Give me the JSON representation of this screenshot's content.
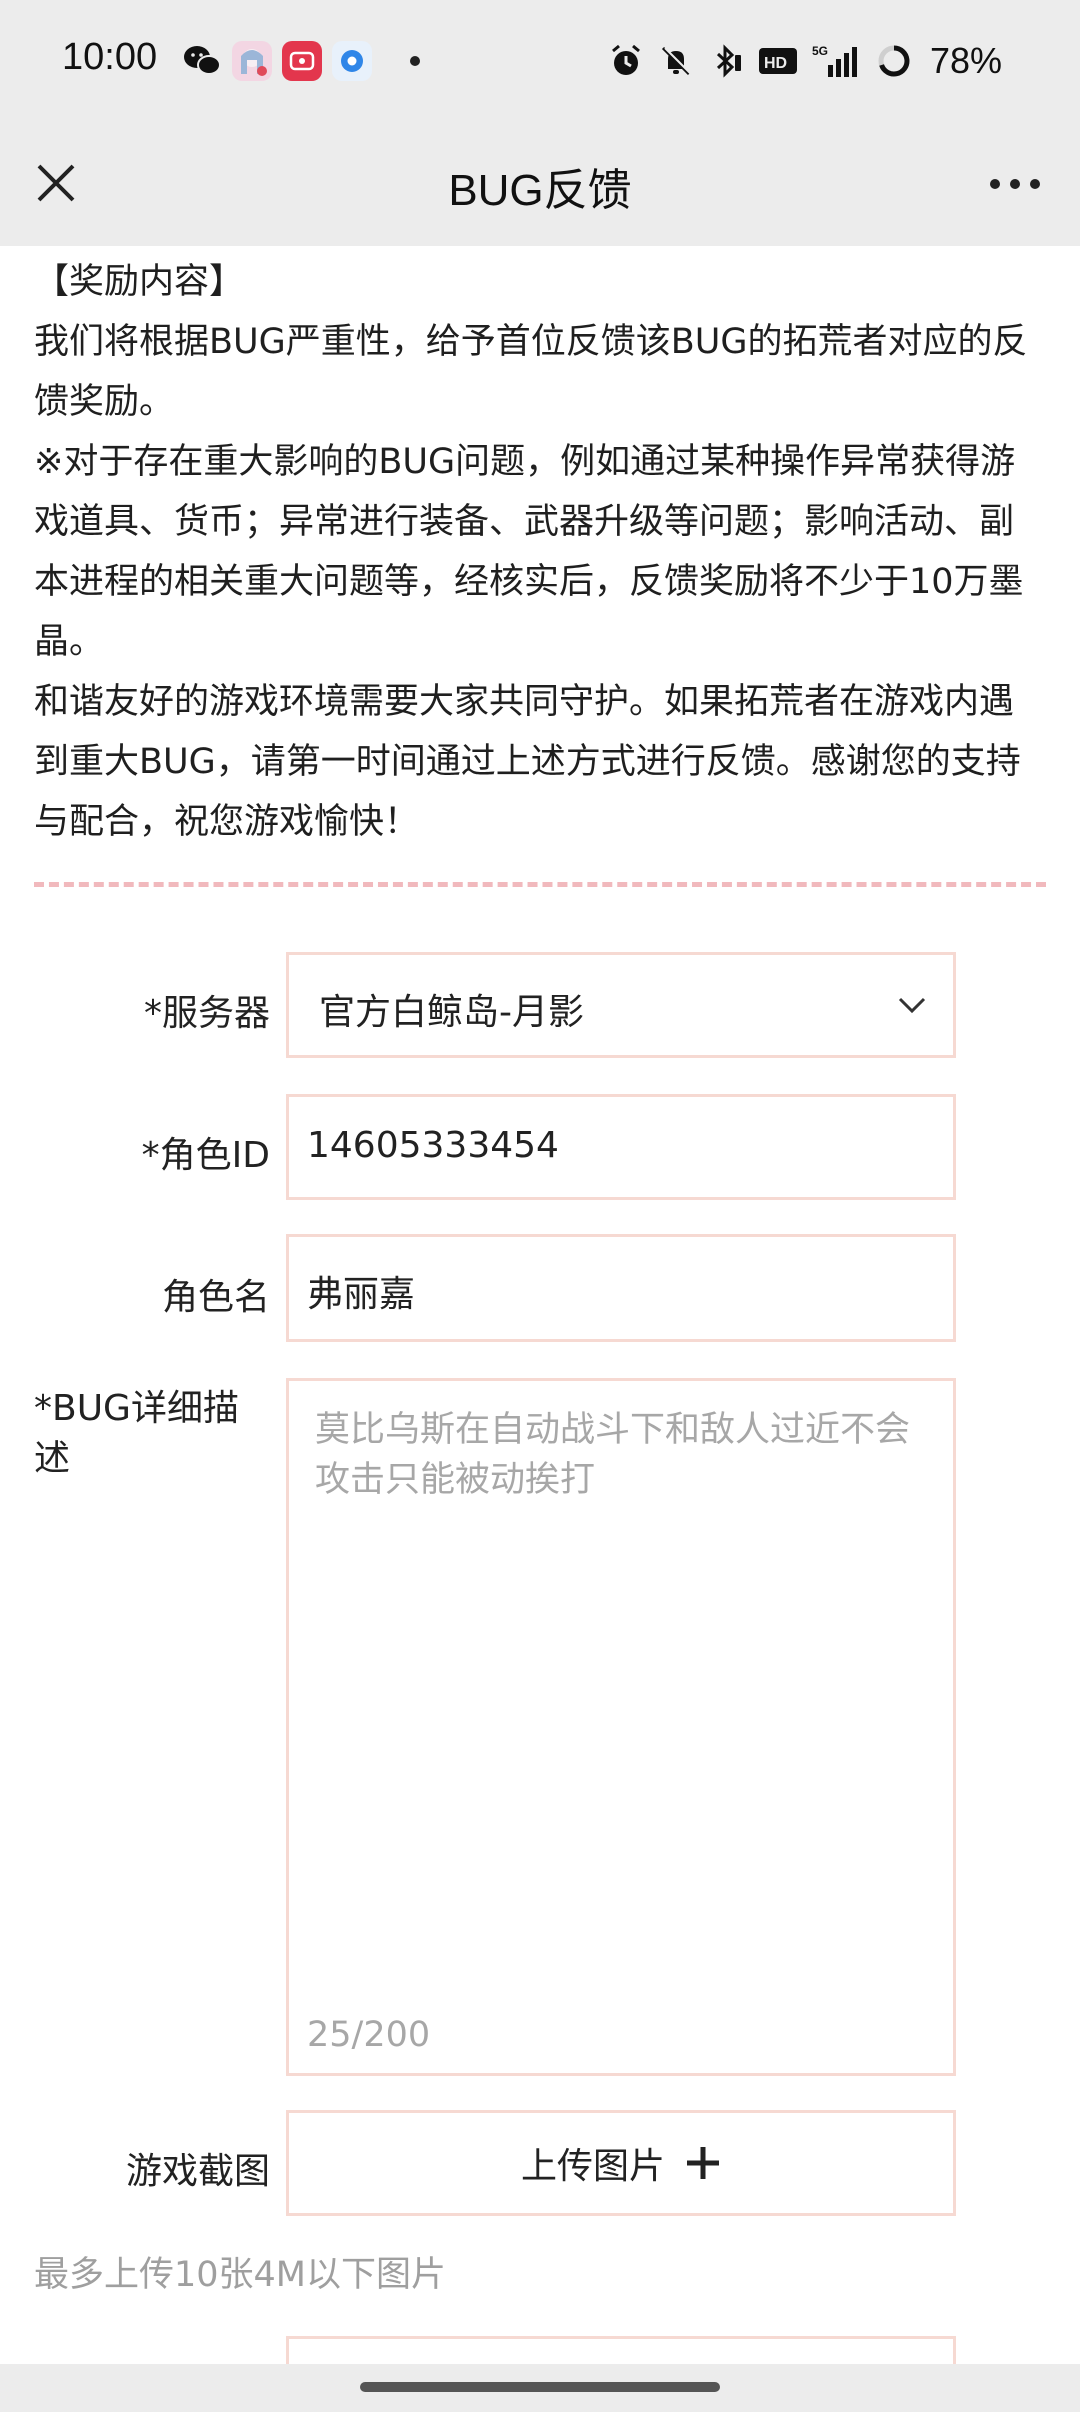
{
  "status_bar": {
    "time": "10:00",
    "battery": "78%",
    "icons_left": [
      "wechat-icon",
      "anime-app-icon",
      "video-app-icon",
      "browser-app-icon"
    ],
    "icons_right": [
      "alarm-icon",
      "mute-icon",
      "bluetooth-icon",
      "hd-icon",
      "5g-signal-icon",
      "battery-ring-icon"
    ]
  },
  "nav": {
    "title": "BUG反馈"
  },
  "content": {
    "reward_heading": "【奖励内容】",
    "paragraph1": "我们将根据BUG严重性，给予首位反馈该BUG的拓荒者对应的反馈奖励。",
    "paragraph2": "※对于存在重大影响的BUG问题，例如通过某种操作异常获得游戏道具、货币；异常进行装备、武器升级等问题；影响活动、副本进程的相关重大问题等，经核实后，反馈奖励将不少于10万墨晶。",
    "paragraph3": "和谐友好的游戏环境需要大家共同守护。如果拓荒者在游戏内遇到重大BUG，请第一时间通过上述方式进行反馈。感谢您的支持与配合，祝您游戏愉快！"
  },
  "form": {
    "server_label": "*服务器",
    "server_value": "官方白鲸岛-月影",
    "role_id_label": "*角色ID",
    "role_id_value": "14605333454",
    "role_name_label": "角色名",
    "role_name_value": "弗丽嘉",
    "desc_label": "*BUG详细描述",
    "desc_placeholder": "莫比乌斯在自动战斗下和敌人过近不会攻击只能被动挨打",
    "desc_counter": "25/200",
    "screenshot_label": "游戏截图",
    "upload_label": "上传图片",
    "upload_hint": "最多上传10张4M以下图片"
  },
  "colors": {
    "chrome_bg": "#ececec",
    "field_border": "#f6d9d2",
    "divider": "#f1b9bd",
    "placeholder": "#a7a7a7"
  }
}
